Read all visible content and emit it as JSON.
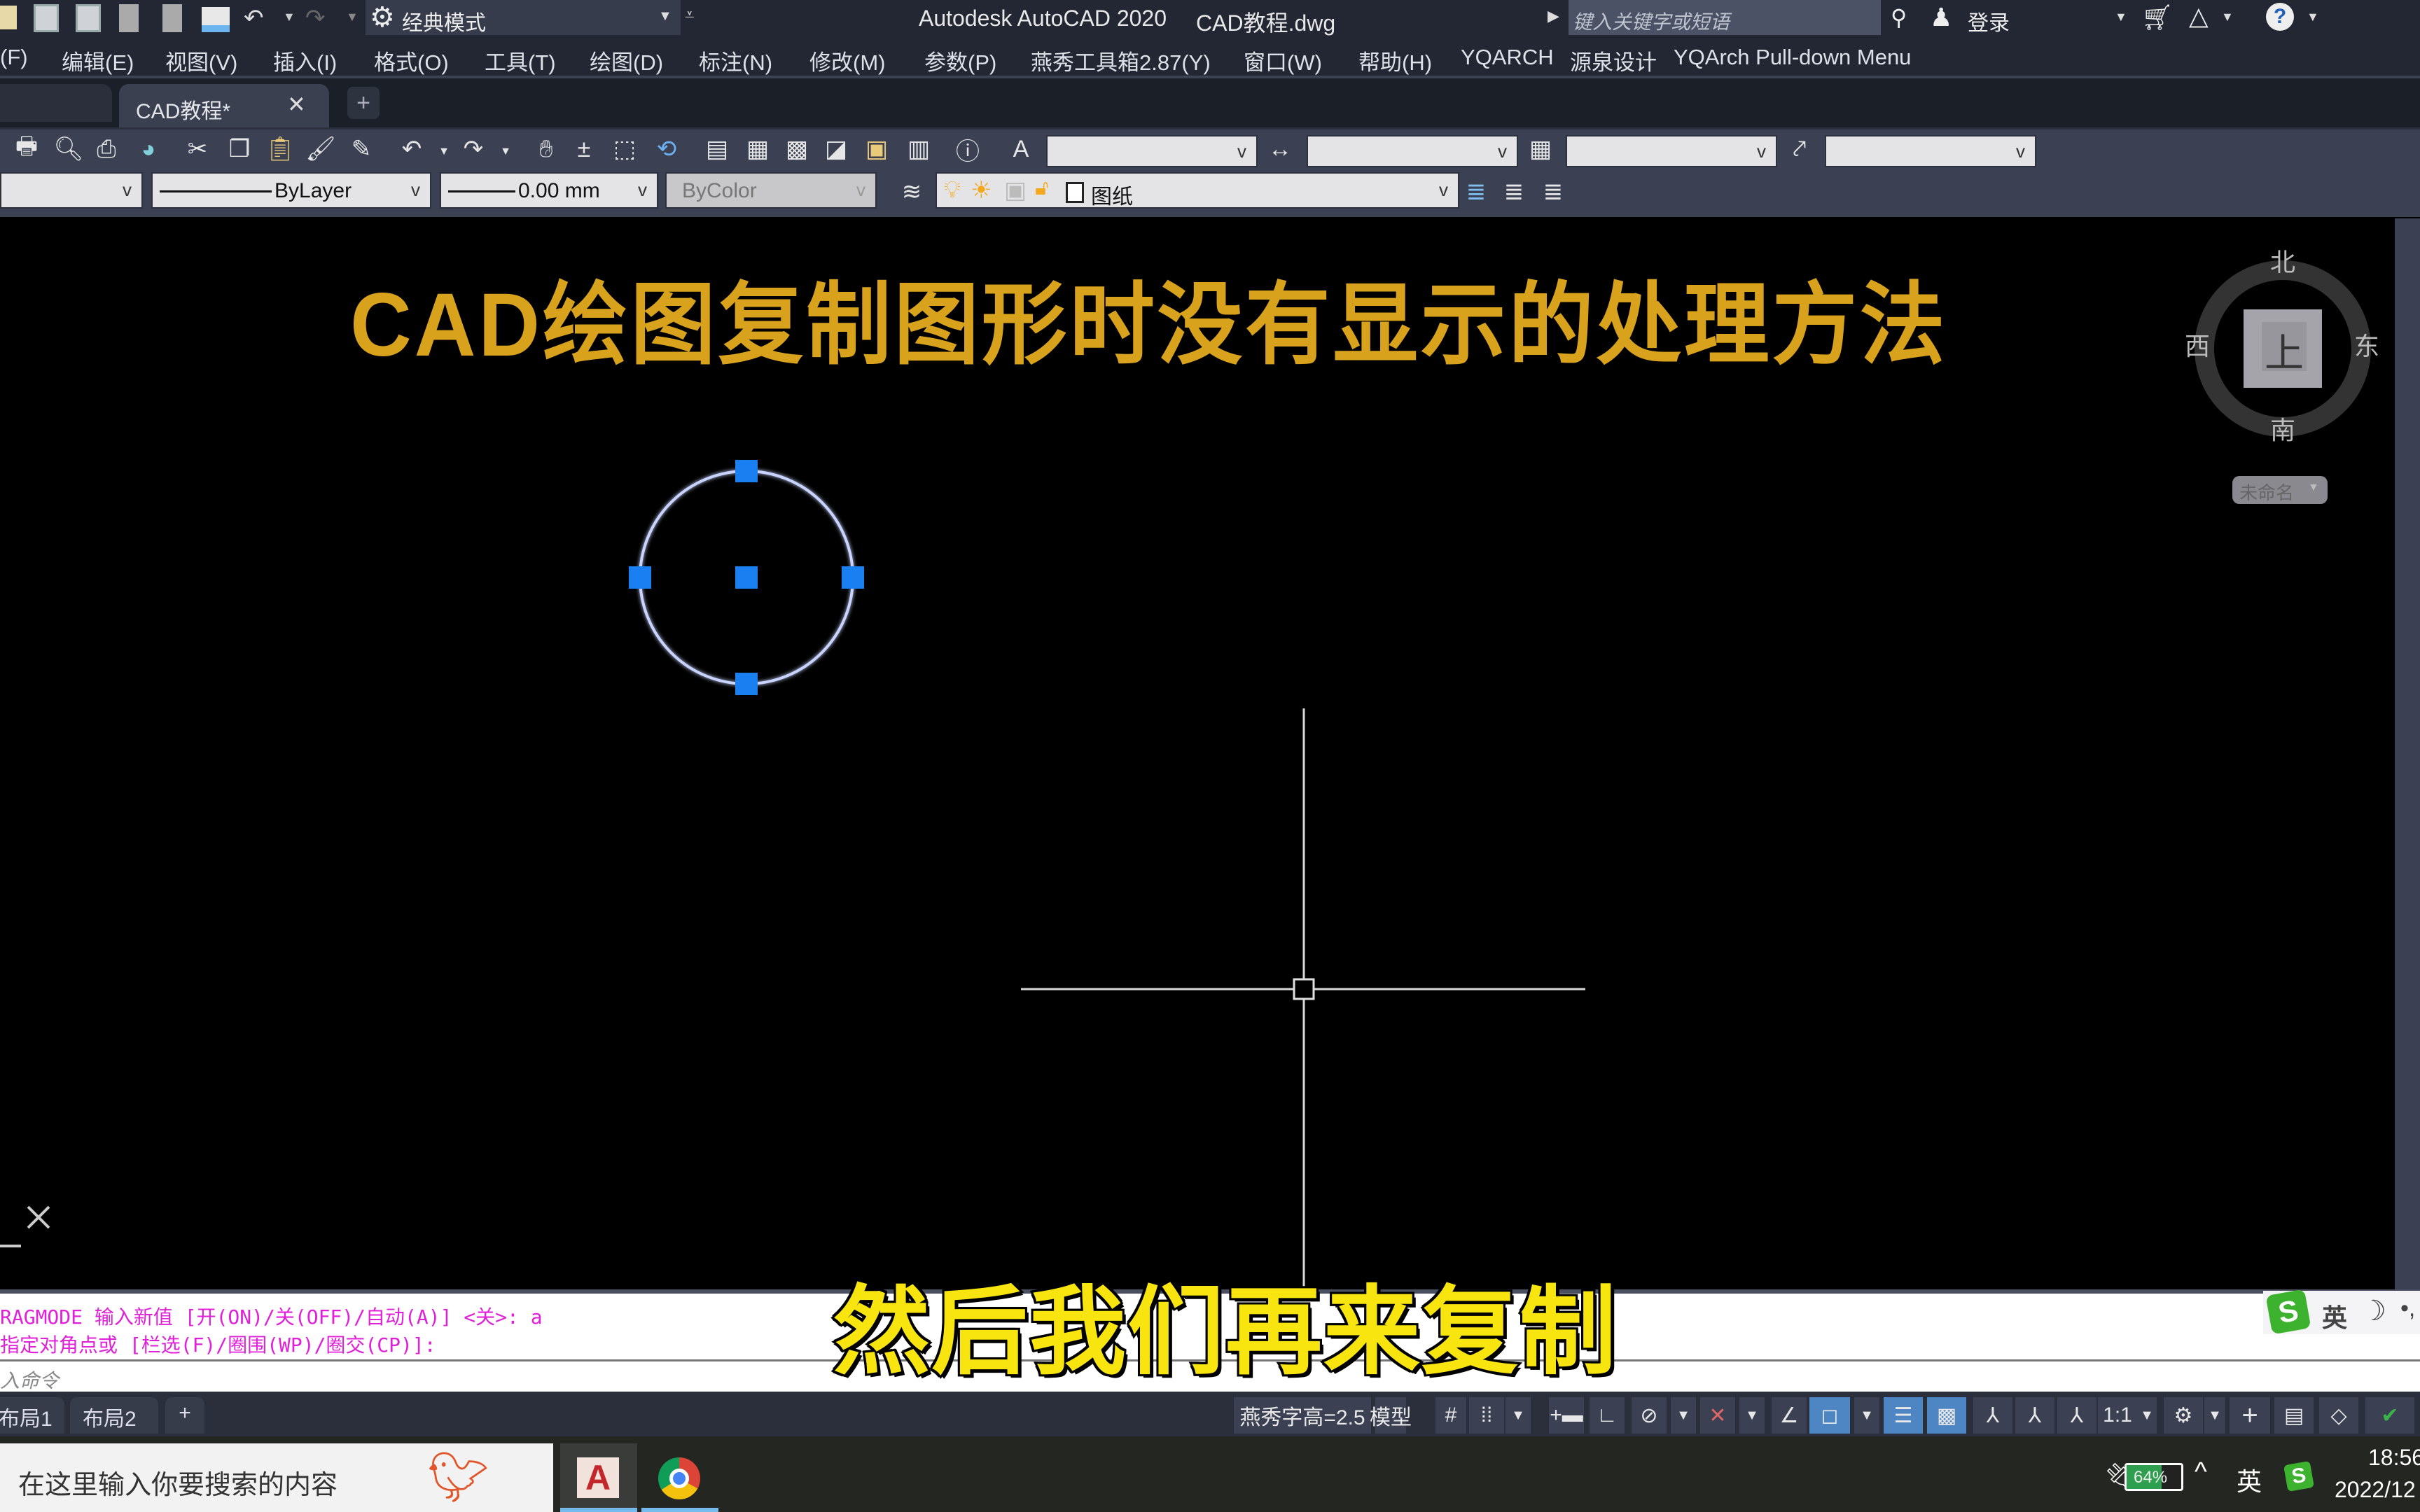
{
  "titlebar": {
    "workspace": "经典模式",
    "app_title": "Autodesk AutoCAD 2020",
    "file_name": "CAD教程.dwg",
    "search_placeholder": "键入关键字或短语",
    "login": "登录",
    "icons": [
      "open-icon",
      "save-icon",
      "save-as-icon",
      "open-sheet-icon",
      "publish-icon",
      "print-icon",
      "undo-icon",
      "redo-icon",
      "gear-icon",
      "binoculars-icon",
      "user-icon",
      "cart-icon",
      "autodesk-a360-icon",
      "help-icon"
    ]
  },
  "menubar": {
    "items": [
      "(F)",
      "编辑(E)",
      "视图(V)",
      "插入(I)",
      "格式(O)",
      "工具(T)",
      "绘图(D)",
      "标注(N)",
      "修改(M)",
      "参数(P)",
      "燕秀工具箱2.87(Y)",
      "窗口(W)",
      "帮助(H)",
      "YQARCH",
      "源泉设计",
      "YQArch Pull-down Menu"
    ]
  },
  "tabs": {
    "active": "CAD教程*",
    "close": "✕",
    "new": "+"
  },
  "toolbar2": {
    "layer_combo": "",
    "linetype": "ByLayer",
    "lineweight": "0.00 mm",
    "plotstyle": "ByColor",
    "layer_name": "图纸",
    "text_style": "",
    "dim_style": "",
    "table_style": "",
    "mleader_style": ""
  },
  "canvas": {
    "drawing_title": "CAD绘图复制图形时没有显示的处理方法",
    "title_color": "#d9a21c",
    "grip_color": "#1a7ff0",
    "viewcube": {
      "north": "北",
      "south": "南",
      "east": "东",
      "west": "西",
      "face": "上",
      "ucs_menu": "未命名"
    }
  },
  "command": {
    "history": [
      "RAGMODE 输入新值 [开(ON)/关(OFF)/自动(A)] <关>: a",
      "指定对角点或 [栏选(F)/圈围(WP)/圈交(CP)]:"
    ],
    "input_placeholder": "入命令",
    "text_color": "#e020d8"
  },
  "ime": {
    "mode": "英"
  },
  "subtitle": "然后我们再来复制",
  "status": {
    "layout_tabs": [
      "布局1",
      "布局2"
    ],
    "add_tab": "+",
    "text_height": "燕秀字高=2.5",
    "model": "模型",
    "scale": "1:1"
  },
  "taskbar": {
    "search_placeholder": "在这里输入你要搜索的内容",
    "battery_percent": 64,
    "battery_label": "64%",
    "ime": "英",
    "time": "18:56",
    "date": "2022/12"
  }
}
